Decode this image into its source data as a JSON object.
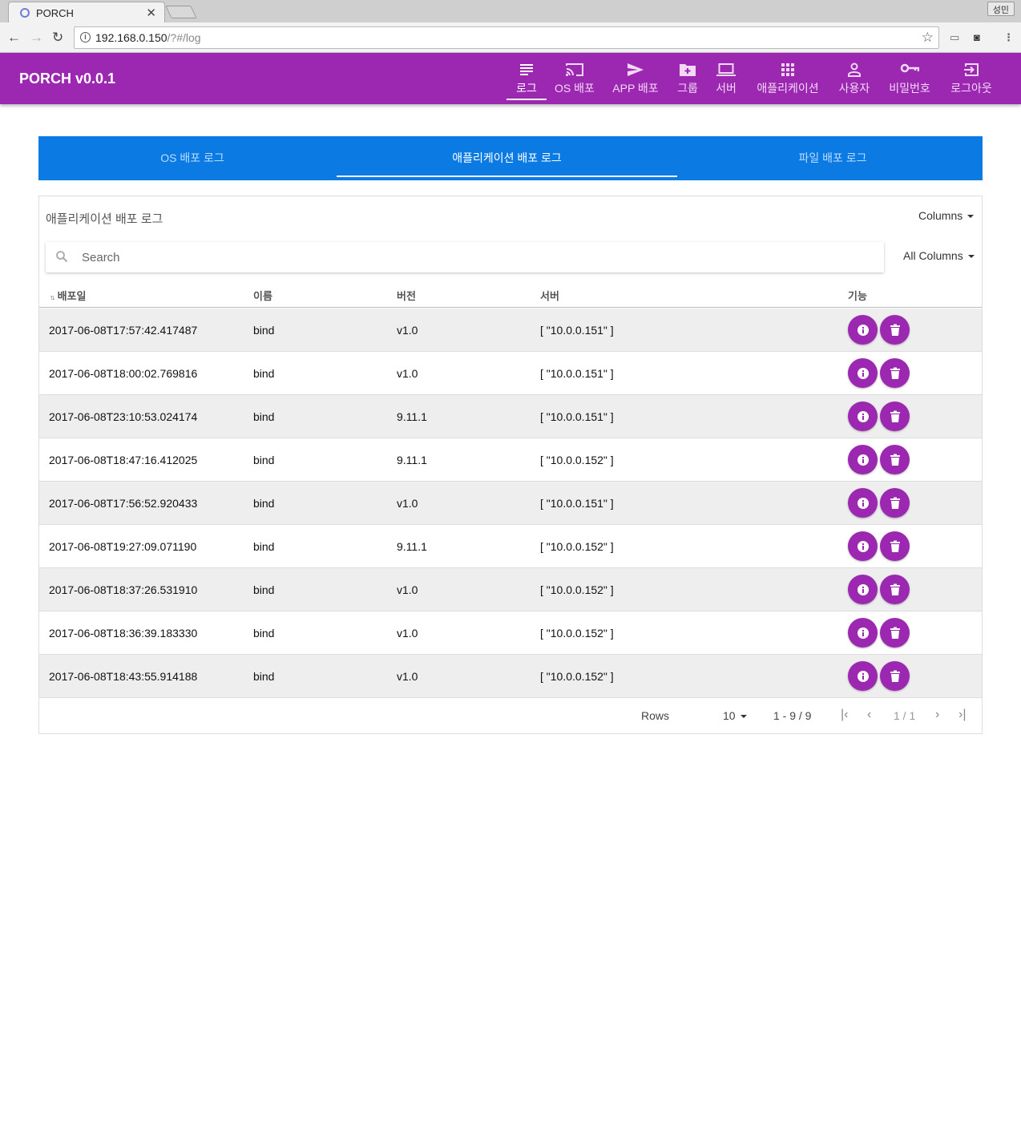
{
  "browser": {
    "tab_title": "PORCH",
    "tab_close": "✕",
    "profile": "성민",
    "url_host": "192.168.0.150",
    "url_path": "/?#/log"
  },
  "app": {
    "brand": "PORCH v0.0.1",
    "accent_color": "#9c27b0",
    "nav": [
      {
        "label": "로그",
        "icon": "list-icon"
      },
      {
        "label": "OS 배포",
        "icon": "cast-icon"
      },
      {
        "label": "APP 배포",
        "icon": "send-icon"
      },
      {
        "label": "그룹",
        "icon": "folder-add-icon"
      },
      {
        "label": "서버",
        "icon": "laptop-icon"
      },
      {
        "label": "애플리케이션",
        "icon": "apps-grid-icon"
      },
      {
        "label": "사용자",
        "icon": "person-icon"
      },
      {
        "label": "비밀번호",
        "icon": "key-icon"
      },
      {
        "label": "로그아웃",
        "icon": "exit-icon"
      }
    ]
  },
  "subtabs": [
    "OS 배포 로그",
    "애플리케이션 배포 로그",
    "파일 배포 로그"
  ],
  "card": {
    "title": "애플리케이션 배포 로그",
    "columns_label": "Columns",
    "all_columns_label": "All Columns",
    "search_placeholder": "Search"
  },
  "table": {
    "headers": [
      "배포일",
      "이름",
      "버전",
      "서버",
      "기능"
    ],
    "rows": [
      [
        "2017-06-08T17:57:42.417487",
        "bind",
        "v1.0",
        "[ \"10.0.0.151\" ]"
      ],
      [
        "2017-06-08T18:00:02.769816",
        "bind",
        "v1.0",
        "[ \"10.0.0.151\" ]"
      ],
      [
        "2017-06-08T23:10:53.024174",
        "bind",
        "9.11.1",
        "[ \"10.0.0.151\" ]"
      ],
      [
        "2017-06-08T18:47:16.412025",
        "bind",
        "9.11.1",
        "[ \"10.0.0.152\" ]"
      ],
      [
        "2017-06-08T17:56:52.920433",
        "bind",
        "v1.0",
        "[ \"10.0.0.151\" ]"
      ],
      [
        "2017-06-08T19:27:09.071190",
        "bind",
        "9.11.1",
        "[ \"10.0.0.152\" ]"
      ],
      [
        "2017-06-08T18:37:26.531910",
        "bind",
        "v1.0",
        "[ \"10.0.0.152\" ]"
      ],
      [
        "2017-06-08T18:36:39.183330",
        "bind",
        "v1.0",
        "[ \"10.0.0.152\" ]"
      ],
      [
        "2017-06-08T18:43:55.914188",
        "bind",
        "v1.0",
        "[ \"10.0.0.152\" ]"
      ]
    ]
  },
  "pagination": {
    "rows_label": "Rows",
    "rows_per_page": "10",
    "range": "1 - 9 / 9",
    "page": "1 / 1"
  }
}
